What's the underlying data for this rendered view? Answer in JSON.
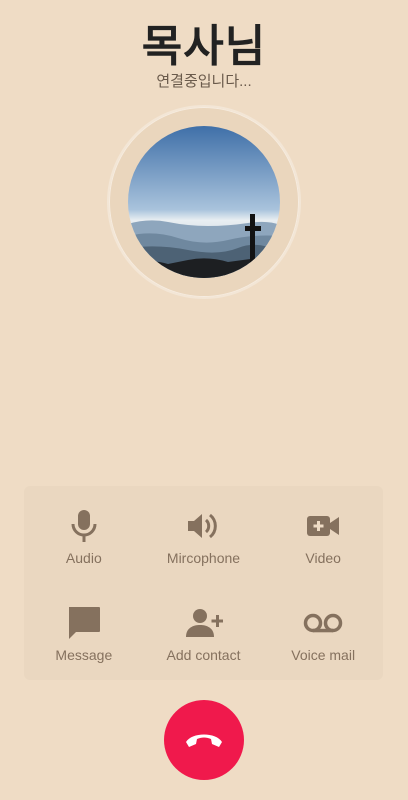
{
  "contact": {
    "name": "목사님",
    "status": "연결중입니다..."
  },
  "actions": [
    {
      "label": "Audio",
      "icon": "microphone-icon"
    },
    {
      "label": "Mircophone",
      "icon": "speaker-icon"
    },
    {
      "label": "Video",
      "icon": "video-plus-icon"
    },
    {
      "label": "Message",
      "icon": "message-icon"
    },
    {
      "label": "Add contact",
      "icon": "add-contact-icon"
    },
    {
      "label": "Voice mail",
      "icon": "voicemail-icon"
    }
  ],
  "end_call": {
    "icon": "phone-hangup-icon"
  },
  "colors": {
    "background": "#efdcc5",
    "panel": "#ead7c0",
    "icon": "#85715e",
    "end_call": "#f0194c"
  }
}
